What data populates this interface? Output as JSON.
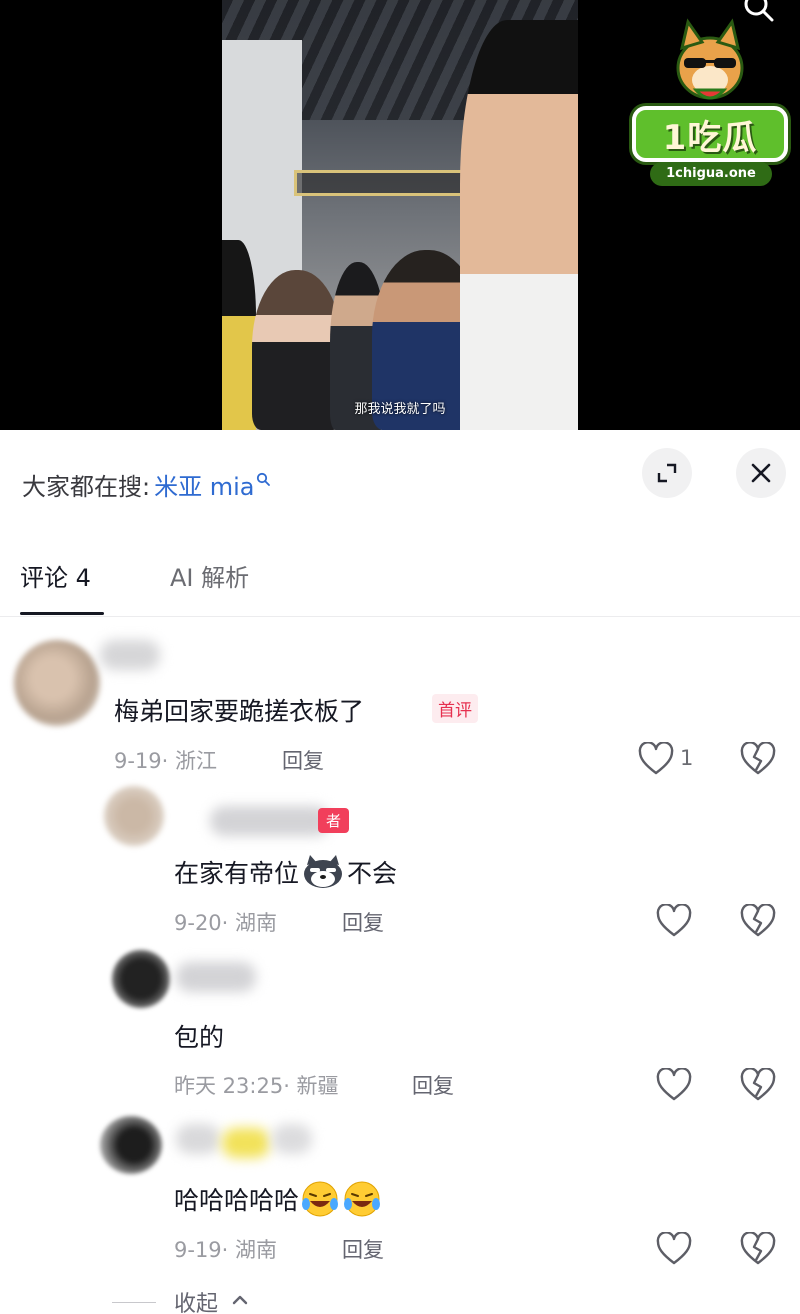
{
  "video": {
    "subtitle": "那我说我就了吗"
  },
  "watermark": {
    "brand": "1吃瓜",
    "site": "1chigua.one"
  },
  "search_bar": {
    "prefix": "大家都在搜:",
    "term": "米亚 mia",
    "term_icon": "search-icon"
  },
  "header_buttons": {
    "expand_icon": "expand-icon",
    "close_icon": "close-icon"
  },
  "tabs": [
    {
      "label": "评论 4",
      "active": true
    },
    {
      "label": "AI 解析",
      "active": false
    }
  ],
  "comments": [
    {
      "text": "梅弟回家要跪搓衣板了",
      "badge": "首评",
      "meta": "9-19· 浙江",
      "reply_label": "回复",
      "likes": "1"
    },
    {
      "text_before": "在家有帝位",
      "emoji": "husky-emoji",
      "text_after": "不会",
      "author_badge": "者",
      "meta": "9-20· 湖南",
      "reply_label": "回复"
    },
    {
      "text": "包的",
      "meta": "昨天 23:25· 新疆",
      "reply_label": "回复"
    },
    {
      "text": "哈哈哈哈哈",
      "emoji": "laughing-crying-emoji",
      "meta": "9-19· 湖南",
      "reply_label": "回复"
    }
  ],
  "collapse_label": "收起",
  "colors": {
    "accent_blue": "#2f6bd1",
    "badge_red": "#e6304f",
    "meta_gray": "#9a9ba1"
  }
}
